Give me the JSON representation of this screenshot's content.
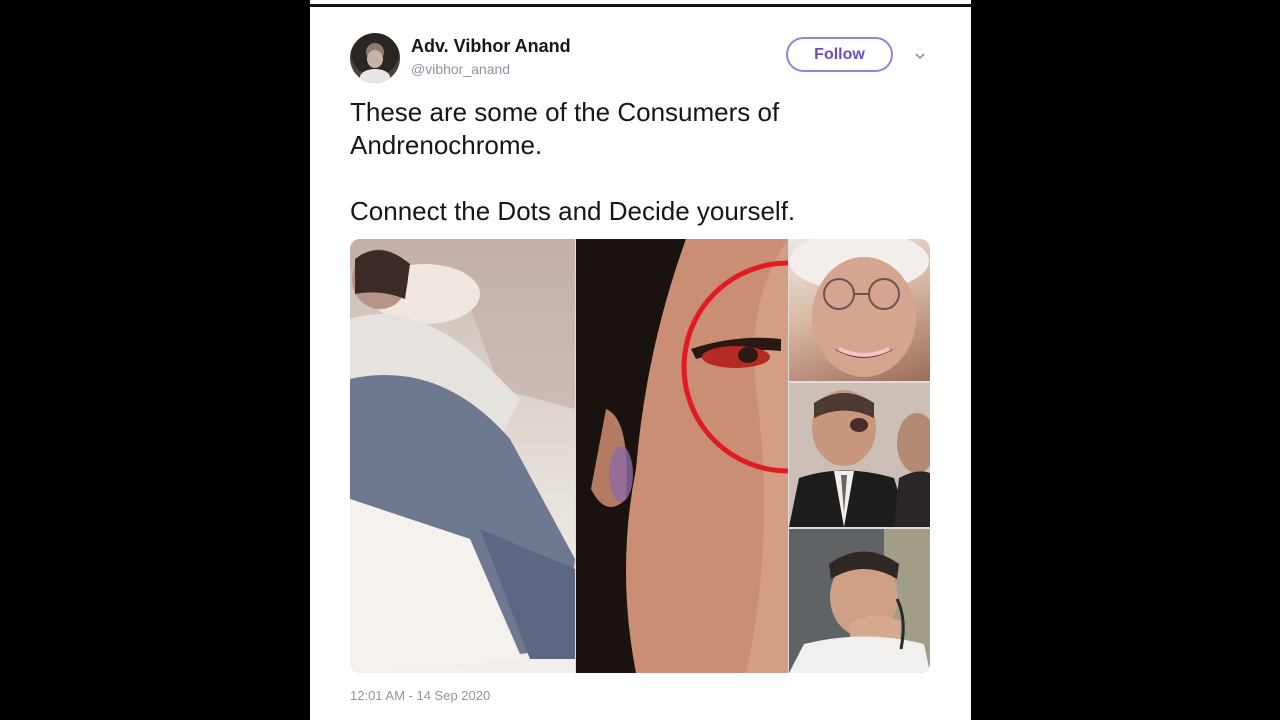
{
  "tweet": {
    "author": {
      "name": "Adv. Vibhor Anand",
      "handle": "@vibhor_anand"
    },
    "follow_label": "Follow",
    "text_lines": [
      "These are some of the Consumers of",
      "Andrenochrome.",
      "Connect the Dots and Decide yourself."
    ],
    "timestamp": "12:01 AM - 14 Sep 2020"
  },
  "colors": {
    "follow_border": "#9b7fd6",
    "follow_text": "#6a4fc0",
    "annotation_circle": "#e11b22",
    "handle_gray": "#8a96a3"
  },
  "icons": [
    "chevron-down-icon"
  ]
}
